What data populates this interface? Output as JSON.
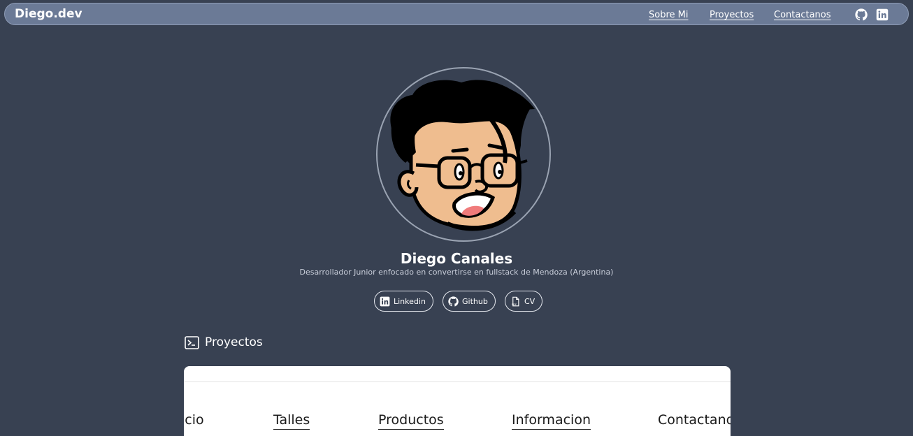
{
  "nav": {
    "brand": "Diego.dev",
    "links": [
      "Sobre Mi",
      "Proyectos",
      "Contactanos"
    ]
  },
  "profile": {
    "name": "Diego Canales",
    "subtitle": "Desarrollador Junior enfocado en convertirse en fullstack de Mendoza (Argentina)",
    "buttons": [
      {
        "label": "Linkedin",
        "icon": "linkedin-icon"
      },
      {
        "label": "Github",
        "icon": "github-icon"
      },
      {
        "label": "CV",
        "icon": "pdf-file-icon"
      }
    ]
  },
  "projects": {
    "title": "Proyectos",
    "preview_nav": [
      "icio",
      "Talles",
      "Productos",
      "Informacion",
      "Contactanos"
    ]
  },
  "colors": {
    "background": "#384152",
    "navbar": "#6b7a96",
    "skin": "#efbd8f",
    "hair": "#000000"
  }
}
